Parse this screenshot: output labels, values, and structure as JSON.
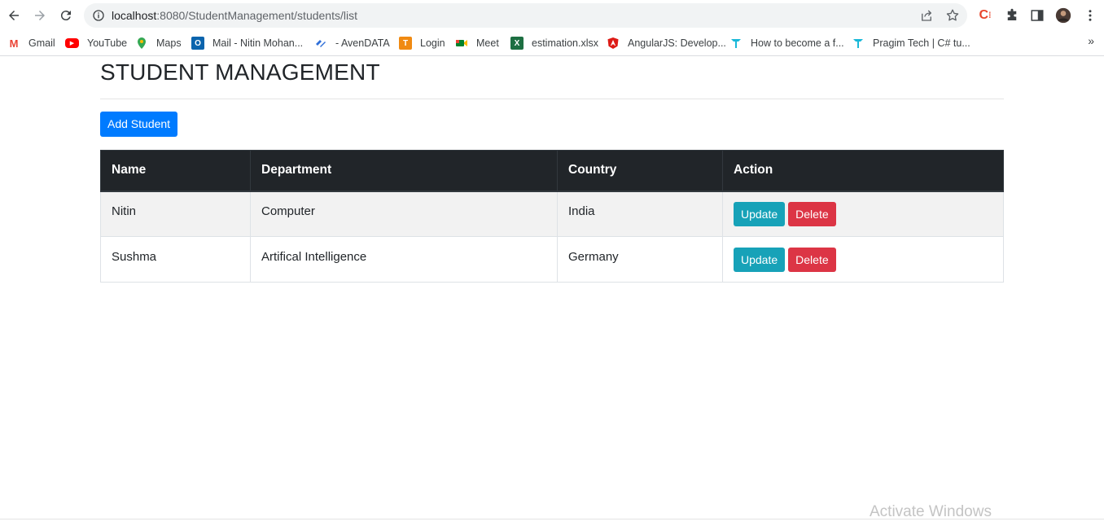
{
  "browser": {
    "url_host": "localhost",
    "url_path": ":8080/StudentManagement/students/list",
    "bookmarks": [
      {
        "label": "Gmail",
        "icon": "gmail-icon",
        "color": "#ea4335",
        "glyph": "M"
      },
      {
        "label": "YouTube",
        "icon": "youtube-icon",
        "color": "#ff0000",
        "glyph": "▶"
      },
      {
        "label": "Maps",
        "icon": "maps-icon",
        "color": "#34a853",
        "glyph": "⬤"
      },
      {
        "label": "Mail - Nitin Mohan...",
        "icon": "outlook-icon",
        "color": "#0a64ad",
        "glyph": "O"
      },
      {
        "label": "- AvenDATA",
        "icon": "avendata-icon",
        "color": "#2f6fd8",
        "glyph": "»"
      },
      {
        "label": "Login",
        "icon": "login-icon",
        "color": "#f08a12",
        "glyph": "T"
      },
      {
        "label": "Meet",
        "icon": "meet-icon",
        "color": "#00832d",
        "glyph": "▸"
      },
      {
        "label": "estimation.xlsx",
        "icon": "excel-icon",
        "color": "#1d6f42",
        "glyph": "X"
      },
      {
        "label": "AngularJS: Develop...",
        "icon": "angular-icon",
        "color": "#dd1b16",
        "glyph": "A"
      },
      {
        "label": "How to become a f...",
        "icon": "pragim-icon",
        "color": "#19b8d8",
        "glyph": "▼"
      },
      {
        "label": "Pragim Tech | C# tu...",
        "icon": "pragim-icon",
        "color": "#19b8d8",
        "glyph": "▼"
      }
    ],
    "more_label": "»"
  },
  "page": {
    "title": "STUDENT MANAGEMENT",
    "add_button": "Add Student"
  },
  "table": {
    "headers": [
      "Name",
      "Department",
      "Country",
      "Action"
    ],
    "rows": [
      {
        "name": "Nitin",
        "department": "Computer",
        "country": "India",
        "update": "Update",
        "delete": "Delete"
      },
      {
        "name": "Sushma",
        "department": "Artifical Intelligence",
        "country": "Germany",
        "update": "Update",
        "delete": "Delete"
      }
    ]
  },
  "watermark": "Activate Windows",
  "colors": {
    "primary": "#007bff",
    "info": "#17a2b8",
    "danger": "#dc3545",
    "dark_header": "#212529"
  }
}
